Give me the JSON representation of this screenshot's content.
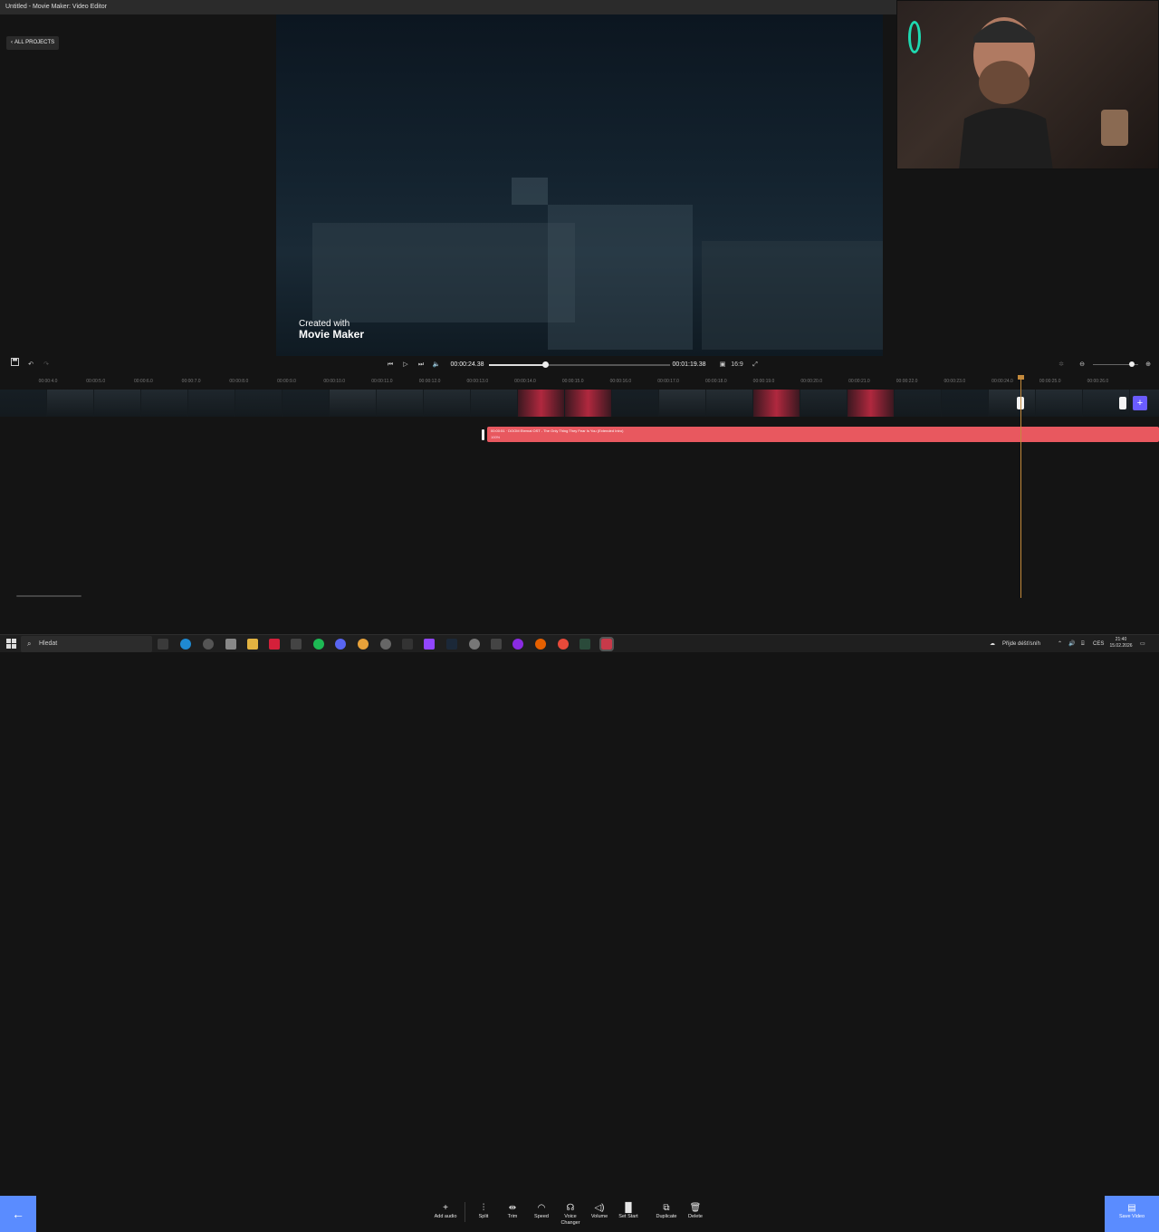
{
  "window": {
    "title": "Untitled - Movie Maker: Video Editor"
  },
  "header": {
    "back_label": "ALL PROJECTS"
  },
  "preview": {
    "watermark_line1": "Created with",
    "watermark_line2": "Movie Maker"
  },
  "playback": {
    "current_time": "00:00:24.38",
    "total_time": "00:01:19.38",
    "progress": 0.31,
    "aspect_ratio": "16:9"
  },
  "ruler": {
    "labels": [
      "00:00:4.0",
      "00:00:5.0",
      "00:00:6.0",
      "00:00:7.0",
      "00:00:8.0",
      "00:00:9.0",
      "00:00:10.0",
      "00:00:11.0",
      "00:00:12.0",
      "00:00:13.0",
      "00:00:14.0",
      "00:00:15.0",
      "00:00:16.0",
      "00:00:17.0",
      "00:00:18.0",
      "00:00:19.0",
      "00:00:20.0",
      "00:00:21.0",
      "00:00:22.0",
      "00:00:23.0",
      "00:00:24.0",
      "00:00:25.0",
      "00:00:26.0"
    ]
  },
  "audio_clip": {
    "title": "00:00:51 · DOOM Eternal OST - The Only Thing They Fear Is You (Extended Intro)",
    "volume": "100%"
  },
  "toolbar": {
    "add_audio": "Add audio",
    "split": "Split",
    "trim": "Trim",
    "speed": "Speed",
    "voice_changer_1": "Voice",
    "voice_changer_2": "Changer",
    "volume": "Volume",
    "set_start": "Set Start",
    "duplicate": "Duplicate",
    "delete": "Delete",
    "save_video": "Save Video"
  },
  "taskbar": {
    "search_placeholder": "Hledat",
    "weather": "Přijde déšť/sníh",
    "lang": "CES",
    "time": "21:40",
    "date": "15.02.2026"
  },
  "colors": {
    "accent": "#5a8cff",
    "audio_clip": "#e8585f",
    "playhead": "#c48a3c",
    "add_clip": "#6a5cff"
  }
}
